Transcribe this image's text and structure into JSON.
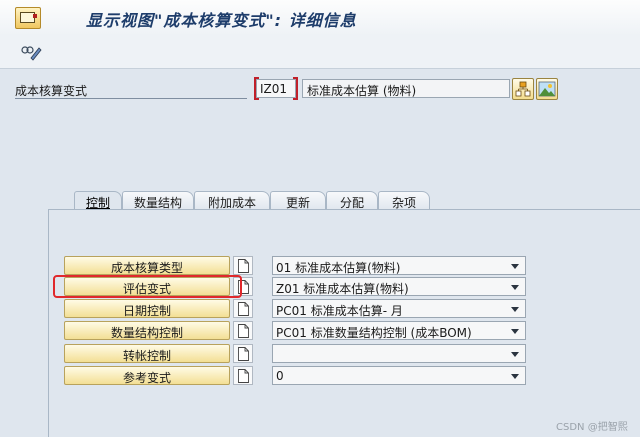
{
  "window": {
    "title": "显示视图\"成本核算变式\": 详细信息"
  },
  "header": {
    "field_label": "成本核算变式",
    "code_value": "IZ01",
    "description": "标准成本估算 (物料)"
  },
  "tabs": [
    {
      "label": "控制",
      "active": true
    },
    {
      "label": "数量结构"
    },
    {
      "label": "附加成本"
    },
    {
      "label": "更新"
    },
    {
      "label": "分配"
    },
    {
      "label": "杂项"
    }
  ],
  "rows": [
    {
      "button": "成本核算类型",
      "value": "01 标准成本估算(物料)"
    },
    {
      "button": "评估变式",
      "value": "Z01 标准成本估算(物料)"
    },
    {
      "button": "日期控制",
      "value": "PC01 标准成本估算- 月"
    },
    {
      "button": "数量结构控制",
      "value": "PC01 标准数量结构控制 (成本BOM)"
    },
    {
      "button": "转帐控制",
      "value": ""
    },
    {
      "button": "参考变式",
      "value": "0"
    }
  ],
  "watermark": "CSDN @把智熙",
  "colors": {
    "highlight": "#e0282c",
    "title": "#1e3d6b"
  }
}
